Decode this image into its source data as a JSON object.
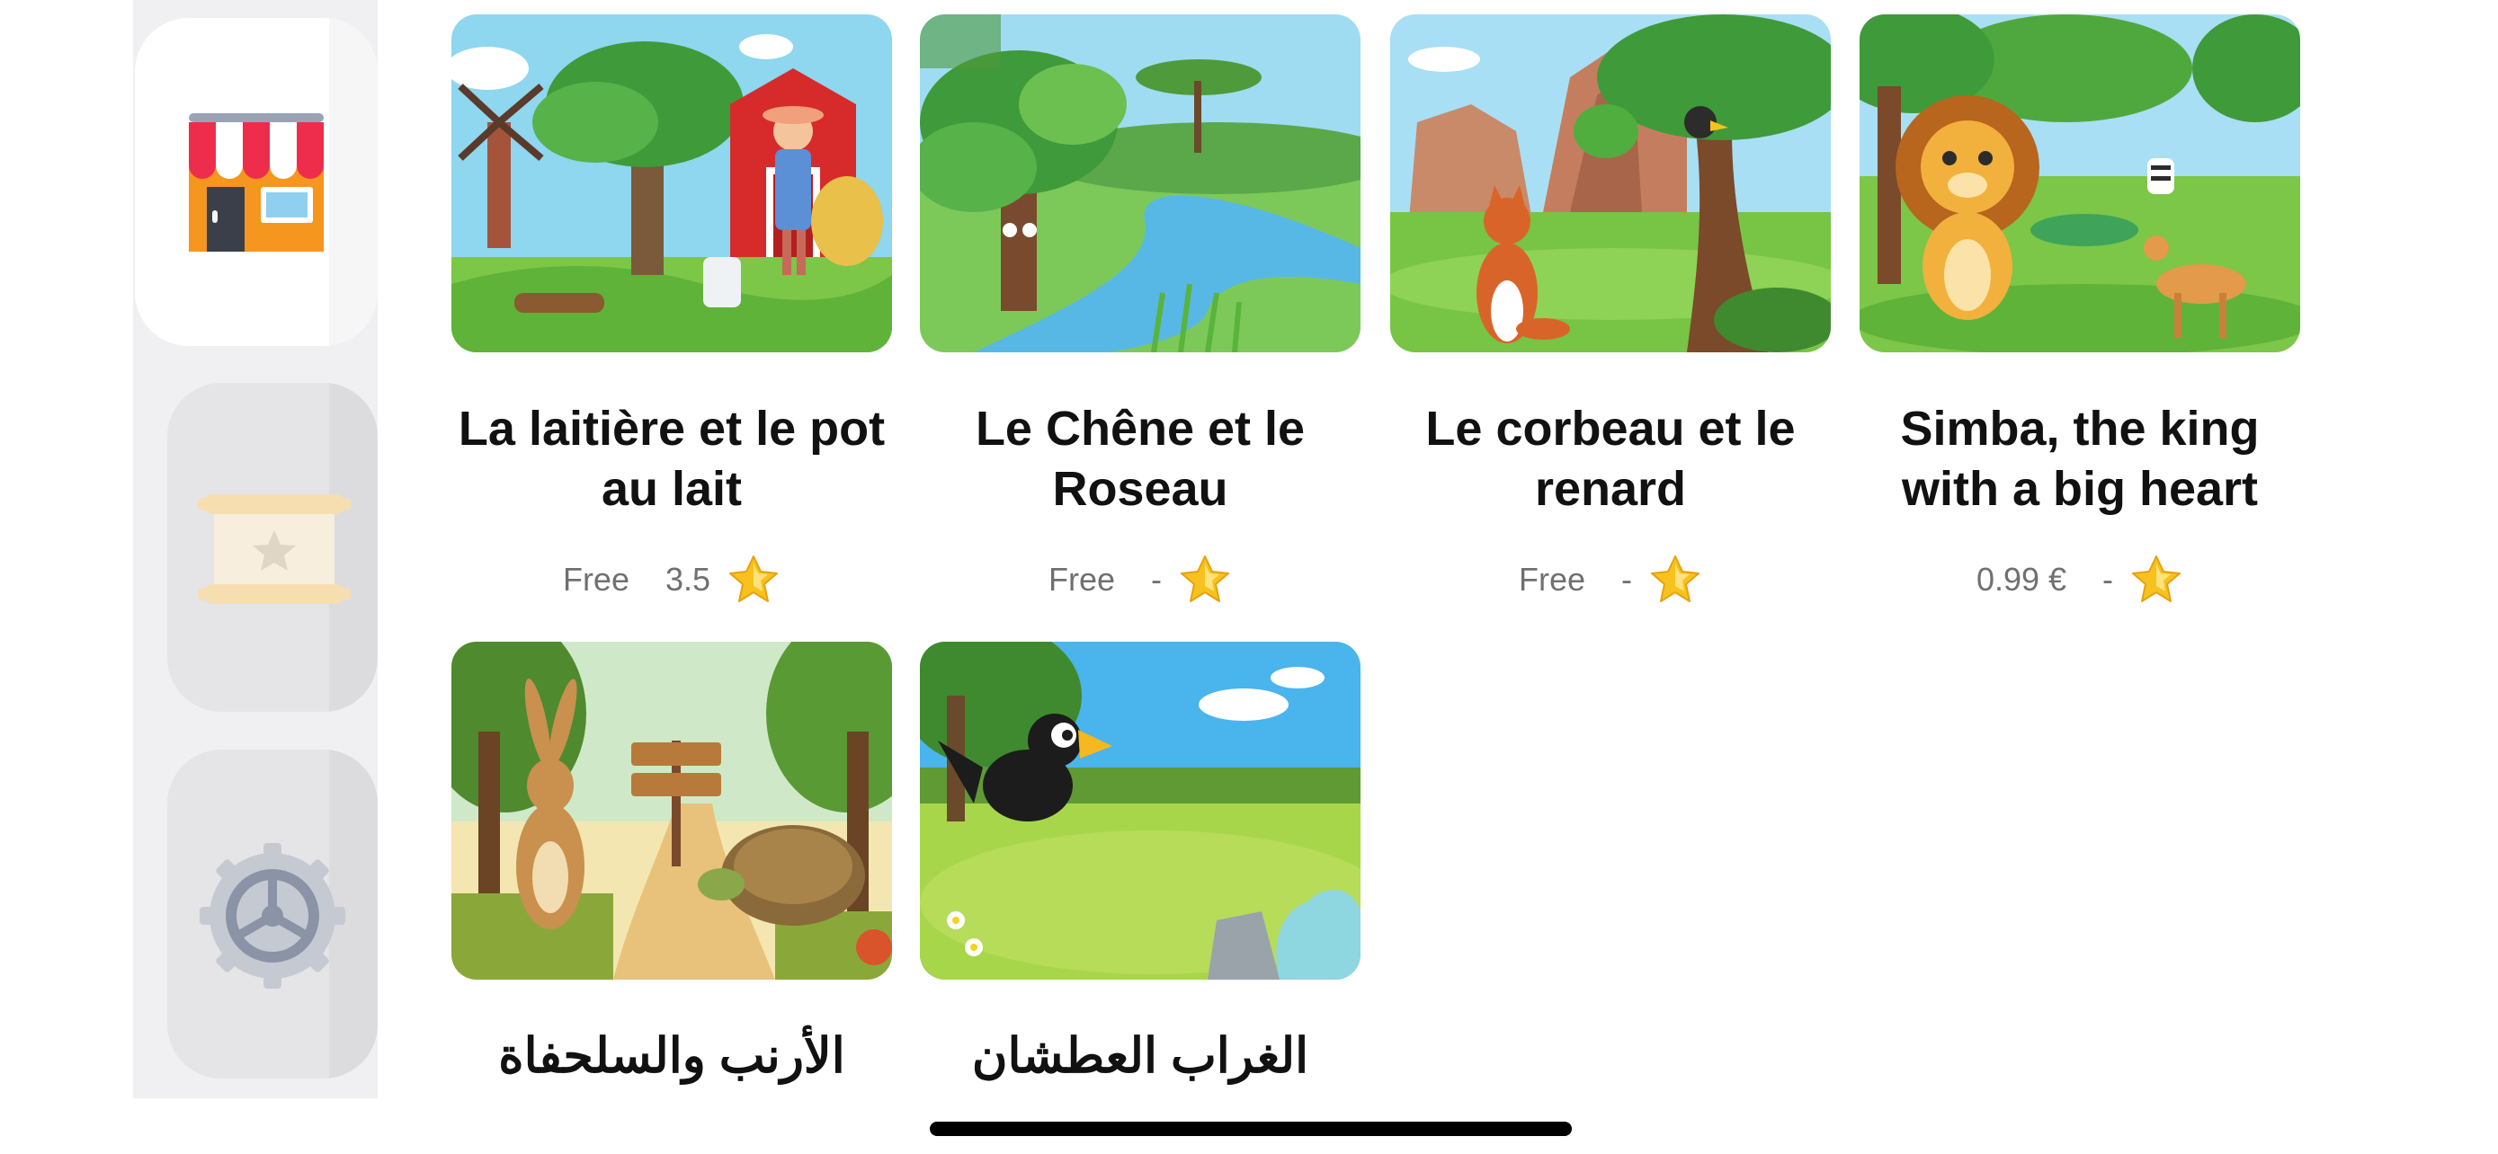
{
  "sidebar": {
    "items": [
      {
        "name": "store",
        "icon": "store-icon",
        "selected": true
      },
      {
        "name": "scroll",
        "icon": "scroll-star-icon",
        "selected": false
      },
      {
        "name": "settings",
        "icon": "settings-gear-icon",
        "selected": false
      }
    ]
  },
  "stories": [
    {
      "title": "La laitière et le pot au lait",
      "price": "Free",
      "rating": "3.5",
      "image": "farm-milkmaid-illustration"
    },
    {
      "title": "Le Chêne et le Roseau",
      "price": "Free",
      "rating": "-",
      "image": "oak-and-reed-river-illustration"
    },
    {
      "title": "Le corbeau et le renard",
      "price": "Free",
      "rating": "-",
      "image": "crow-and-fox-illustration"
    },
    {
      "title": "Simba, the king with a big heart",
      "price": "0.99 €",
      "rating": "-",
      "image": "lion-savanna-illustration"
    },
    {
      "title": "الأرنب والسلحفاة",
      "image": "hare-and-tortoise-illustration"
    },
    {
      "title": "الغراب العطشان",
      "image": "thirsty-crow-illustration"
    }
  ],
  "colors": {
    "sidebar_bg": "#f0f0f2",
    "selected_tab_bg": "#ffffff",
    "inactive_tab_bg": "#e5e5e8",
    "title_text": "#111111",
    "meta_text": "#707070",
    "star": "#f7c21e"
  }
}
